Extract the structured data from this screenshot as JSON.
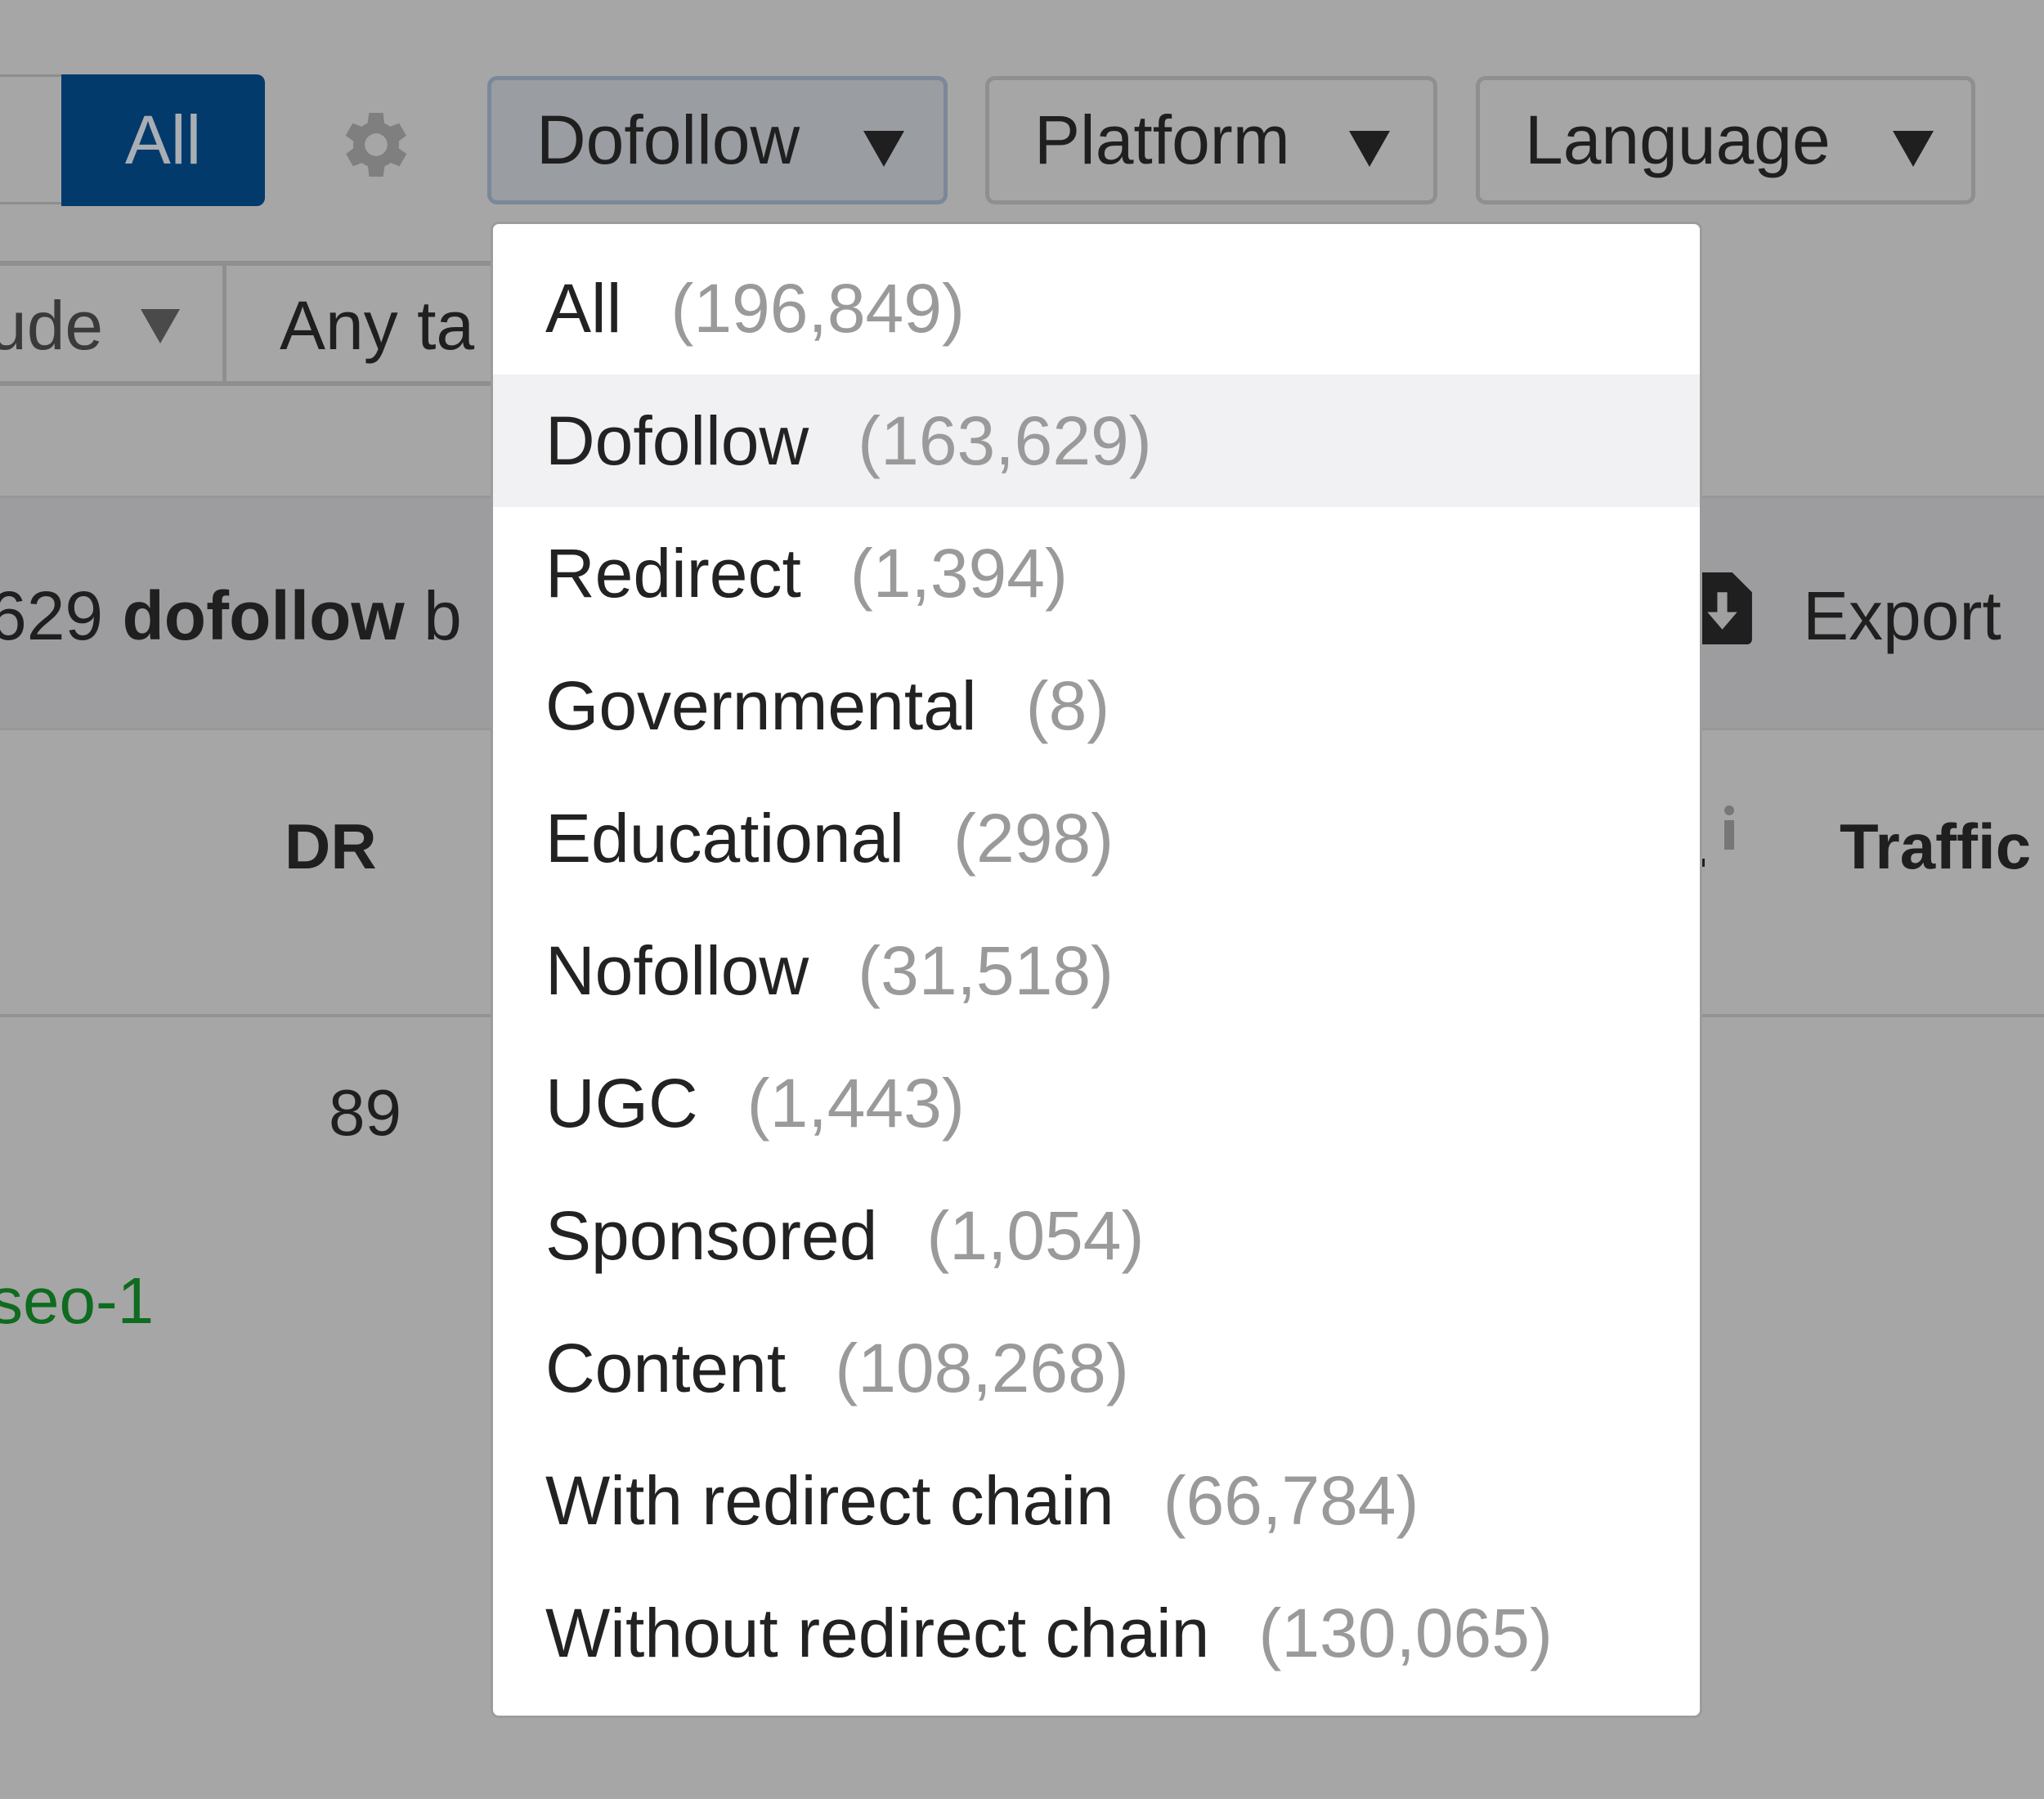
{
  "toolbar": {
    "all_label": "All",
    "settings_icon": "gear-icon",
    "filters": [
      {
        "label": "Dofollow",
        "icon": "caret-down-icon",
        "active": true
      },
      {
        "label": "Platform",
        "icon": "caret-down-icon",
        "active": false
      },
      {
        "label": "Language",
        "icon": "caret-down-icon",
        "active": false
      }
    ]
  },
  "filters_row2": {
    "partial_select_label": "ude",
    "target_label": "Any ta"
  },
  "summary": {
    "count_partial": "629",
    "type_bold": "dofollow",
    "trailing_partial": "b",
    "export_label": "Export",
    "export_icon": "file-download-icon"
  },
  "table": {
    "headers": {
      "dr": "DR",
      "traffic": "Traffic",
      "info_icon": "info-icon"
    },
    "rows": [
      {
        "dr": "89",
        "link_partial": "seo-1"
      }
    ]
  },
  "dropdown": {
    "selected": "Dofollow",
    "items": [
      {
        "label": "All",
        "count": "(196,849)"
      },
      {
        "label": "Dofollow",
        "count": "(163,629)"
      },
      {
        "label": "Redirect",
        "count": "(1,394)"
      },
      {
        "label": "Governmental",
        "count": "(8)"
      },
      {
        "label": "Educational",
        "count": "(298)"
      },
      {
        "label": "Nofollow",
        "count": "(31,518)"
      },
      {
        "label": "UGC",
        "count": "(1,443)"
      },
      {
        "label": "Sponsored",
        "count": "(1,054)"
      },
      {
        "label": "Content",
        "count": "(108,268)"
      },
      {
        "label": "With redirect chain",
        "count": "(66,784)"
      },
      {
        "label": "Without redirect chain",
        "count": "(130,065)"
      }
    ]
  },
  "colors": {
    "overlay_bg": "#a6a6a6",
    "primary_button": "#013a6b",
    "link_green": "#0f6b1f",
    "count_gray": "#9a9a9a",
    "highlight_row": "#f1f1f3"
  }
}
